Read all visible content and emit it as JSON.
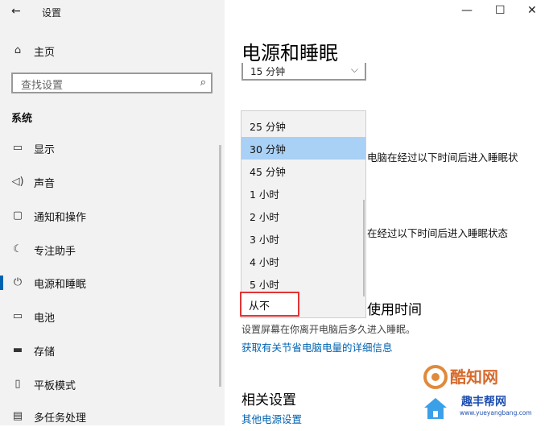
{
  "window": {
    "title": "设置",
    "back_icon": "arrow-left-icon",
    "controls": {
      "minimize": "—",
      "maximize": "☐",
      "close": "✕"
    }
  },
  "sidebar": {
    "home_label": "主页",
    "search_placeholder": "查找设置",
    "section": "系统",
    "items": [
      {
        "label": "显示",
        "icon": "monitor-icon"
      },
      {
        "label": "声音",
        "icon": "speaker-icon"
      },
      {
        "label": "通知和操作",
        "icon": "notification-icon"
      },
      {
        "label": "专注助手",
        "icon": "moon-icon"
      },
      {
        "label": "电源和睡眠",
        "icon": "power-icon",
        "active": true
      },
      {
        "label": "电池",
        "icon": "battery-icon"
      },
      {
        "label": "存储",
        "icon": "storage-icon"
      },
      {
        "label": "平板模式",
        "icon": "tablet-icon"
      },
      {
        "label": "多任务处理",
        "icon": "multitask-icon"
      }
    ]
  },
  "main": {
    "title": "电源和睡眠",
    "combo_value": "15 分钟",
    "line1": "电脑在经过以下时间后进入睡眠状",
    "line2": "在经过以下时间后进入睡眠状态",
    "sub_heading": "使用时间",
    "description": "设置屏幕在你离开电脑后多久进入睡眠。",
    "detail_link": "获取有关节省电脑电量的详细信息",
    "related_heading": "相关设置",
    "other_power_link": "其他电源设置"
  },
  "dropdown": {
    "options": [
      "25 分钟",
      "30 分钟",
      "45 分钟",
      "1 小时",
      "2 小时",
      "3 小时",
      "4 小时",
      "5 小时"
    ],
    "selected": "30 分钟",
    "never": "从不"
  },
  "watermark": {
    "brand": "酷知网",
    "name": "趣丰帮网",
    "url": "www.yueyangbang.com"
  }
}
